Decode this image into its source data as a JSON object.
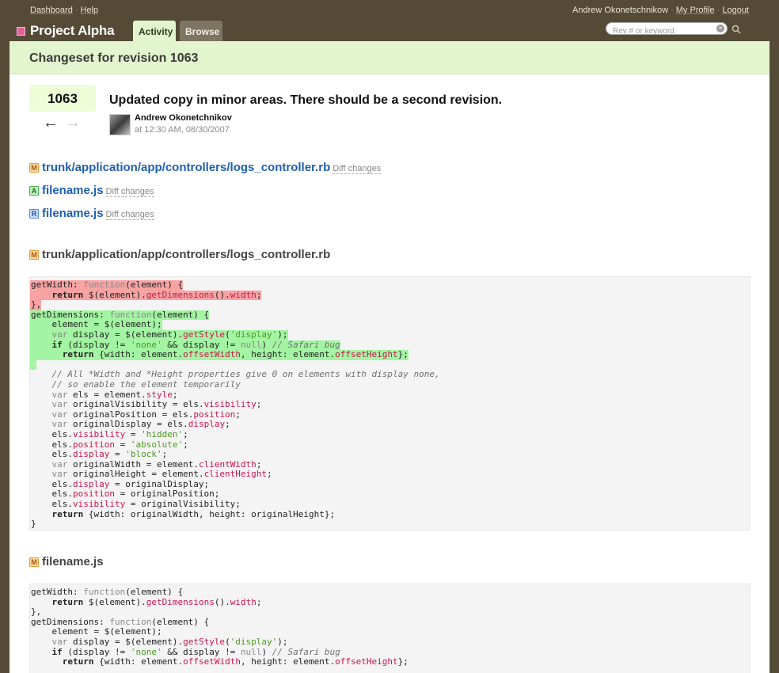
{
  "topnav": {
    "dashboard": "Dashboard",
    "help": "Help",
    "user_name": "Andrew Okonetschnikow",
    "my_profile": "My Profile",
    "logout": "Logout",
    "separator": "·"
  },
  "header": {
    "project_title": "Project Alpha",
    "tabs": [
      {
        "label": "Activity"
      },
      {
        "label": "Browse"
      }
    ],
    "search_placeholder": "Rev # or keyword"
  },
  "page": {
    "title": "Changeset for revision 1063"
  },
  "changeset": {
    "revision": "1063",
    "prev_arrow": "←",
    "next_arrow": "→",
    "message": "Updated copy in minor areas. There should be a second revision.",
    "author": "Andrew Okonetchnikov",
    "timestamp": "at 12:30 AM, 08/30/2007"
  },
  "files": [
    {
      "badge": "M",
      "name": "trunk/application/app/controllers/logs_controller.rb",
      "diff_label": "Diff changes"
    },
    {
      "badge": "A",
      "name": "filename.js",
      "diff_label": "Diff changes"
    },
    {
      "badge": "R",
      "name": "filename.js",
      "diff_label": "Diff changes"
    }
  ],
  "sections": [
    {
      "badge": "M",
      "title": "trunk/application/app/controllers/logs_controller.rb",
      "lines": [
        {
          "type": "del",
          "t": [
            [
              "",
              "getWidth: "
            ],
            [
              "kw",
              "function"
            ],
            [
              "",
              "(element) {"
            ]
          ]
        },
        {
          "type": "del",
          "t": [
            [
              "",
              "    "
            ],
            [
              "b",
              "return"
            ],
            [
              "",
              " $(element)."
            ],
            [
              "prop",
              "getDimensions"
            ],
            [
              "",
              "()."
            ],
            [
              "prop",
              "width"
            ],
            [
              "",
              ";"
            ]
          ]
        },
        {
          "type": "del",
          "t": [
            [
              "",
              "},"
            ]
          ]
        },
        {
          "type": "add",
          "t": [
            [
              "",
              "getDimensions: "
            ],
            [
              "kw",
              "function"
            ],
            [
              "",
              "(element) {"
            ]
          ]
        },
        {
          "type": "add",
          "t": [
            [
              "",
              "    element = $(element);"
            ]
          ]
        },
        {
          "type": "add",
          "t": [
            [
              "",
              "    "
            ],
            [
              "kw",
              "var"
            ],
            [
              "",
              " display = $(element)."
            ],
            [
              "prop",
              "getStyle"
            ],
            [
              "",
              "("
            ],
            [
              "str",
              "'display'"
            ],
            [
              "",
              ");"
            ]
          ]
        },
        {
          "type": "add",
          "t": [
            [
              "",
              "    "
            ],
            [
              "b",
              "if"
            ],
            [
              "",
              " (display != "
            ],
            [
              "str",
              "'none'"
            ],
            [
              "",
              " && display != "
            ],
            [
              "kw",
              "null"
            ],
            [
              "",
              ") "
            ],
            [
              "cm",
              "// Safari bug"
            ]
          ]
        },
        {
          "type": "add",
          "t": [
            [
              "",
              "      "
            ],
            [
              "b",
              "return"
            ],
            [
              "",
              " {width: element."
            ],
            [
              "prop",
              "offsetWidth"
            ],
            [
              "",
              ", height: element."
            ],
            [
              "prop",
              "offsetHeight"
            ],
            [
              "",
              "};"
            ]
          ]
        },
        {
          "type": "stub",
          "t": [
            [
              "",
              ""
            ]
          ]
        },
        {
          "type": "ctx",
          "t": [
            [
              "",
              "    "
            ],
            [
              "cm",
              "// All *Width and *Height properties give 0 on elements with display none,"
            ]
          ]
        },
        {
          "type": "ctx",
          "t": [
            [
              "",
              "    "
            ],
            [
              "cm",
              "// so enable the element temporarily"
            ]
          ]
        },
        {
          "type": "ctx",
          "t": [
            [
              "",
              "    "
            ],
            [
              "kw",
              "var"
            ],
            [
              "",
              " els = element."
            ],
            [
              "prop",
              "style"
            ],
            [
              "",
              ";"
            ]
          ]
        },
        {
          "type": "ctx",
          "t": [
            [
              "",
              "    "
            ],
            [
              "kw",
              "var"
            ],
            [
              "",
              " originalVisibility = els."
            ],
            [
              "prop",
              "visibility"
            ],
            [
              "",
              ";"
            ]
          ]
        },
        {
          "type": "ctx",
          "t": [
            [
              "",
              "    "
            ],
            [
              "kw",
              "var"
            ],
            [
              "",
              " originalPosition = els."
            ],
            [
              "prop",
              "position"
            ],
            [
              "",
              ";"
            ]
          ]
        },
        {
          "type": "ctx",
          "t": [
            [
              "",
              "    "
            ],
            [
              "kw",
              "var"
            ],
            [
              "",
              " originalDisplay = els."
            ],
            [
              "prop",
              "display"
            ],
            [
              "",
              ";"
            ]
          ]
        },
        {
          "type": "ctx",
          "t": [
            [
              "",
              "    els."
            ],
            [
              "prop",
              "visibility"
            ],
            [
              "",
              " = "
            ],
            [
              "str",
              "'hidden'"
            ],
            [
              "",
              ";"
            ]
          ]
        },
        {
          "type": "ctx",
          "t": [
            [
              "",
              "    els."
            ],
            [
              "prop",
              "position"
            ],
            [
              "",
              " = "
            ],
            [
              "str",
              "'absolute'"
            ],
            [
              "",
              ";"
            ]
          ]
        },
        {
          "type": "ctx",
          "t": [
            [
              "",
              "    els."
            ],
            [
              "prop",
              "display"
            ],
            [
              "",
              " = "
            ],
            [
              "str",
              "'block'"
            ],
            [
              "",
              ";"
            ]
          ]
        },
        {
          "type": "ctx",
          "t": [
            [
              "",
              "    "
            ],
            [
              "kw",
              "var"
            ],
            [
              "",
              " originalWidth = element."
            ],
            [
              "prop",
              "clientWidth"
            ],
            [
              "",
              ";"
            ]
          ]
        },
        {
          "type": "ctx",
          "t": [
            [
              "",
              "    "
            ],
            [
              "kw",
              "var"
            ],
            [
              "",
              " originalHeight = element."
            ],
            [
              "prop",
              "clientHeight"
            ],
            [
              "",
              ";"
            ]
          ]
        },
        {
          "type": "ctx",
          "t": [
            [
              "",
              "    els."
            ],
            [
              "prop",
              "display"
            ],
            [
              "",
              " = originalDisplay;"
            ]
          ]
        },
        {
          "type": "ctx",
          "t": [
            [
              "",
              "    els."
            ],
            [
              "prop",
              "position"
            ],
            [
              "",
              " = originalPosition;"
            ]
          ]
        },
        {
          "type": "ctx",
          "t": [
            [
              "",
              "    els."
            ],
            [
              "prop",
              "visibility"
            ],
            [
              "",
              " = originalVisibility;"
            ]
          ]
        },
        {
          "type": "ctx",
          "t": [
            [
              "",
              "    "
            ],
            [
              "b",
              "return"
            ],
            [
              "",
              " {width: originalWidth, height: originalHeight};"
            ]
          ]
        },
        {
          "type": "ctx",
          "t": [
            [
              "",
              "}"
            ]
          ]
        }
      ]
    },
    {
      "badge": "M",
      "title": "filename.js",
      "lines": [
        {
          "type": "ctx",
          "t": [
            [
              "",
              "getWidth: "
            ],
            [
              "kw",
              "function"
            ],
            [
              "",
              "(element) {"
            ]
          ]
        },
        {
          "type": "ctx",
          "t": [
            [
              "",
              "    "
            ],
            [
              "b",
              "return"
            ],
            [
              "",
              " $(element)."
            ],
            [
              "prop",
              "getDimensions"
            ],
            [
              "",
              "()."
            ],
            [
              "prop",
              "width"
            ],
            [
              "",
              ";"
            ]
          ]
        },
        {
          "type": "ctx",
          "t": [
            [
              "",
              "},"
            ]
          ]
        },
        {
          "type": "ctx",
          "t": [
            [
              "",
              "getDimensions: "
            ],
            [
              "kw",
              "function"
            ],
            [
              "",
              "(element) {"
            ]
          ]
        },
        {
          "type": "ctx",
          "t": [
            [
              "",
              "    element = $(element);"
            ]
          ]
        },
        {
          "type": "ctx",
          "t": [
            [
              "",
              "    "
            ],
            [
              "kw",
              "var"
            ],
            [
              "",
              " display = $(element)."
            ],
            [
              "prop",
              "getStyle"
            ],
            [
              "",
              "("
            ],
            [
              "str",
              "'display'"
            ],
            [
              "",
              ");"
            ]
          ]
        },
        {
          "type": "ctx",
          "t": [
            [
              "",
              "    "
            ],
            [
              "b",
              "if"
            ],
            [
              "",
              " (display != "
            ],
            [
              "str",
              "'none'"
            ],
            [
              "",
              " && display != "
            ],
            [
              "kw",
              "null"
            ],
            [
              "",
              ") "
            ],
            [
              "cm",
              "// Safari bug"
            ]
          ]
        },
        {
          "type": "ctx",
          "t": [
            [
              "",
              "      "
            ],
            [
              "b",
              "return"
            ],
            [
              "",
              " {width: element."
            ],
            [
              "prop",
              "offsetWidth"
            ],
            [
              "",
              ", height: element."
            ],
            [
              "prop",
              "offsetHeight"
            ],
            [
              "",
              "};"
            ]
          ]
        }
      ]
    }
  ]
}
